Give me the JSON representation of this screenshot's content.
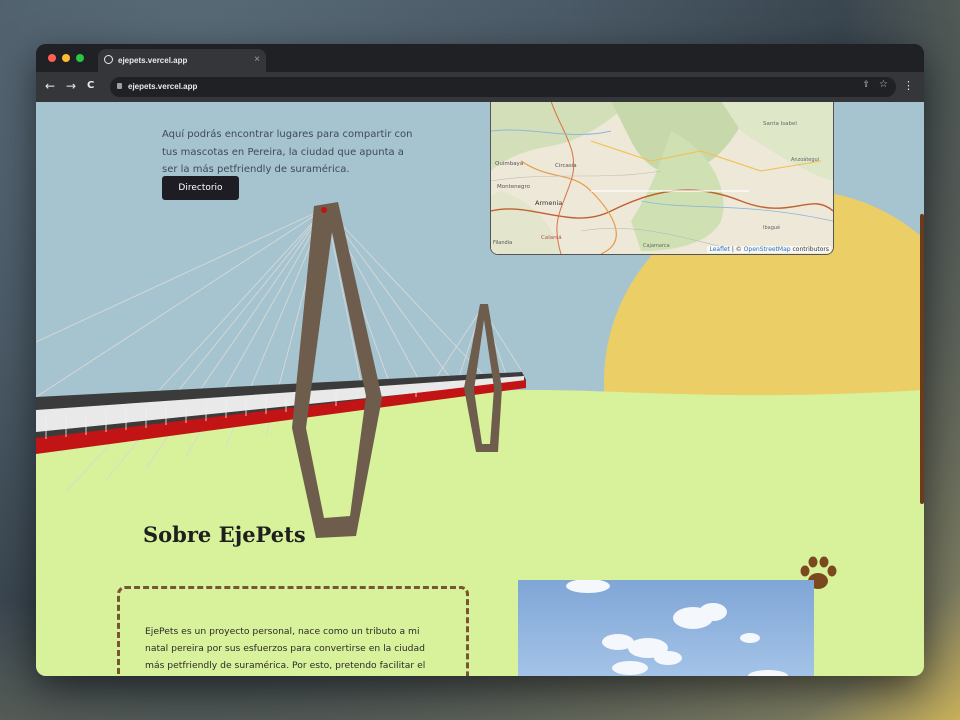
{
  "browser": {
    "tab_title": "ejepets.vercel.app",
    "tab_close": "×",
    "url": "ejepets.vercel.app",
    "nav": {
      "back": "←",
      "forward": "→",
      "reload": "C"
    },
    "menu_icon": "⋮",
    "share_icon": "⇪",
    "bookmark_icon": "☆"
  },
  "hero": {
    "description": "Aquí podrás encontrar lugares para compartir con tus mascotas en Pereira, la ciudad que apunta a ser la más petfriendly de suramérica.",
    "button_label": "Directorio"
  },
  "map": {
    "places": [
      "Santa Isabel",
      "Quimbaya",
      "Circasia",
      "Montenegro",
      "Armenia",
      "Calarcá",
      "Filandia",
      "Anzoátegui",
      "Ibagué",
      "Cajamarca"
    ],
    "attribution_leaflet": "Leaflet",
    "attribution_sep": " | © ",
    "attribution_osm": "OpenStreetMap",
    "attribution_tail": " contributors"
  },
  "about": {
    "title": "Sobre EjePets",
    "text": "EjePets es un proyecto personal, nace como un tributo a mi natal pereira por sus esfuerzos para convertirse en la ciudad más petfriendly de suramérica. Por esto, pretendo facilitar el"
  },
  "colors": {
    "sky": "#a6c4cf",
    "sun": "#ebcf66",
    "grass": "#d7f29a",
    "button_bg": "#1f1d24",
    "paw": "#7a4a1e",
    "box_border": "#7a5533"
  }
}
